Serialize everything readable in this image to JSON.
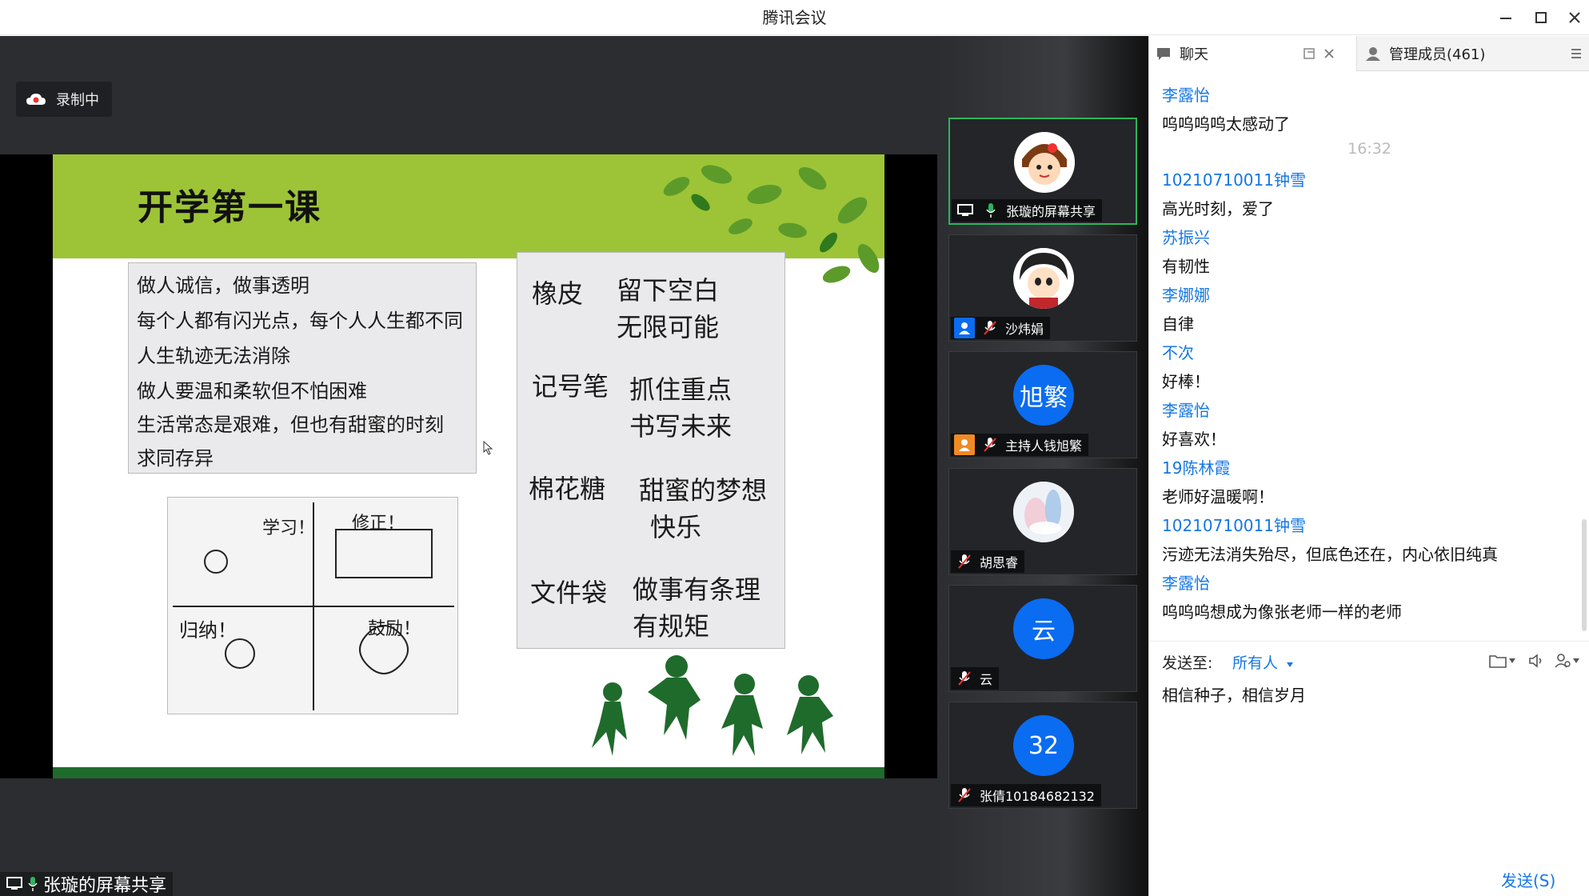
{
  "window": {
    "title": "腾讯会议"
  },
  "recording": {
    "label": "录制中"
  },
  "slide": {
    "title": "开学第一课",
    "note_left_lines": [
      "做人诚信，做事透明",
      "每个人都有闪光点，每个人人生都不同",
      "人生轨迹无法消除",
      "做人要温和柔软但不怕困难",
      "生活常态是艰难，但也有甜蜜的时刻",
      "求同存异"
    ],
    "note_right_lines": [
      {
        "a": "橡皮",
        "b": "留下空白",
        "c": "无限可能"
      },
      {
        "a": "记号笔",
        "b": "抓住重点",
        "c": "书写未来"
      },
      {
        "a": "棉花糖",
        "b": "甜蜜的梦想",
        "c": "快乐"
      },
      {
        "a": "文件袋",
        "b": "做事有条理",
        "c": "有规矩"
      }
    ],
    "comic_texts": [
      "学习！",
      "修正！",
      "归纳！",
      "鼓励！"
    ]
  },
  "share_indicator": {
    "label": "张璇的屏幕共享"
  },
  "participants": [
    {
      "name": "张璇的屏幕共享",
      "avatar_text": "",
      "mic": "on",
      "badge": "share",
      "active": true
    },
    {
      "name": "沙炜娟",
      "avatar_text": "",
      "mic": "off",
      "badge": "user"
    },
    {
      "name": "主持人钱旭繁",
      "avatar_text": "旭繁",
      "mic": "off",
      "badge": "host"
    },
    {
      "name": "胡思睿",
      "avatar_text": "",
      "mic": "off",
      "badge": ""
    },
    {
      "name": "云",
      "avatar_text": "云",
      "mic": "off",
      "badge": ""
    },
    {
      "name": "张倩10184682132",
      "avatar_text": "32",
      "mic": "off",
      "badge": ""
    }
  ],
  "chat": {
    "tab_chat": "聊天",
    "tab_members": "管理成员(461)",
    "messages": [
      {
        "kind": "sender",
        "text": "李露怡"
      },
      {
        "kind": "text",
        "text": "呜呜呜呜太感动了"
      },
      {
        "kind": "time",
        "text": "16:32"
      },
      {
        "kind": "sender",
        "text": "10210710011钟雪"
      },
      {
        "kind": "text",
        "text": "高光时刻，爱了"
      },
      {
        "kind": "sender",
        "text": "苏振兴"
      },
      {
        "kind": "text",
        "text": "有韧性"
      },
      {
        "kind": "sender",
        "text": "李娜娜"
      },
      {
        "kind": "text",
        "text": "自律"
      },
      {
        "kind": "sender",
        "text": "不次"
      },
      {
        "kind": "text",
        "text": "好棒！"
      },
      {
        "kind": "sender",
        "text": "李露怡"
      },
      {
        "kind": "text",
        "text": "好喜欢！"
      },
      {
        "kind": "sender",
        "text": "19陈林霞"
      },
      {
        "kind": "text",
        "text": "老师好温暖啊！"
      },
      {
        "kind": "sender",
        "text": "10210710011钟雪"
      },
      {
        "kind": "text",
        "text": "污迹无法消失殆尽，但底色还在，内心依旧纯真"
      },
      {
        "kind": "sender",
        "text": "李露怡"
      },
      {
        "kind": "text",
        "text": "呜呜呜想成为像张老师一样的老师"
      }
    ],
    "send_to_label": "发送至:",
    "send_to_target": "所有人",
    "input_text": "相信种子，相信岁月",
    "send_button": "发送(S)"
  },
  "colors": {
    "accent": "#1677e5",
    "active_border": "#2fb45a",
    "slide_green": "#9dc437"
  }
}
